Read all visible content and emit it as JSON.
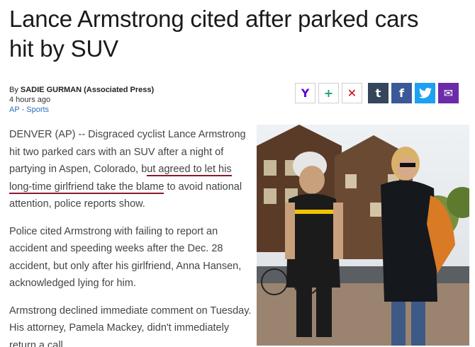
{
  "article": {
    "headline": "Lance Armstrong cited after parked cars hit by SUV",
    "byline_prefix": "By ",
    "author": "SADIE GURMAN (Associated Press)",
    "timestamp": "4 hours ago",
    "section": "AP - Sports",
    "p1_before": "DENVER (AP) -- Disgraced cyclist Lance Armstrong hit two parked cars with an SUV after a night of partying in Aspen, Colorado, b",
    "p1_highlight": "ut agreed to let his long-time girlfriend take the blame",
    "p1_after": " to avoid national attention, police reports show.",
    "p2": "Police cited Armstrong with failing to report an accident and speeding weeks after the Dec. 28 accident, but only after his girlfriend, Anna Hansen, acknowledged lying for him.",
    "p3": "Armstrong declined immediate comment on Tuesday. His attorney, Pamela Mackey, didn't immediately return a call."
  },
  "share": {
    "yahoo": {
      "glyph": "Y",
      "color": "#5f01d1",
      "icon": "yahoo-icon"
    },
    "add": {
      "glyph": "+",
      "color": "#1aa36b",
      "icon": "plus-icon"
    },
    "close": {
      "glyph": "✕",
      "color": "#d0021b",
      "icon": "close-icon"
    },
    "tumblr": {
      "glyph": "t",
      "color": "#35465c",
      "icon": "tumblr-icon"
    },
    "facebook": {
      "glyph": "f",
      "color": "#3b5998",
      "icon": "facebook-icon"
    },
    "twitter": {
      "glyph": "🐦",
      "color": "#1da1f2",
      "icon": "twitter-icon"
    },
    "mail": {
      "glyph": "✉",
      "color": "#6a2ca8",
      "icon": "mail-icon"
    }
  }
}
